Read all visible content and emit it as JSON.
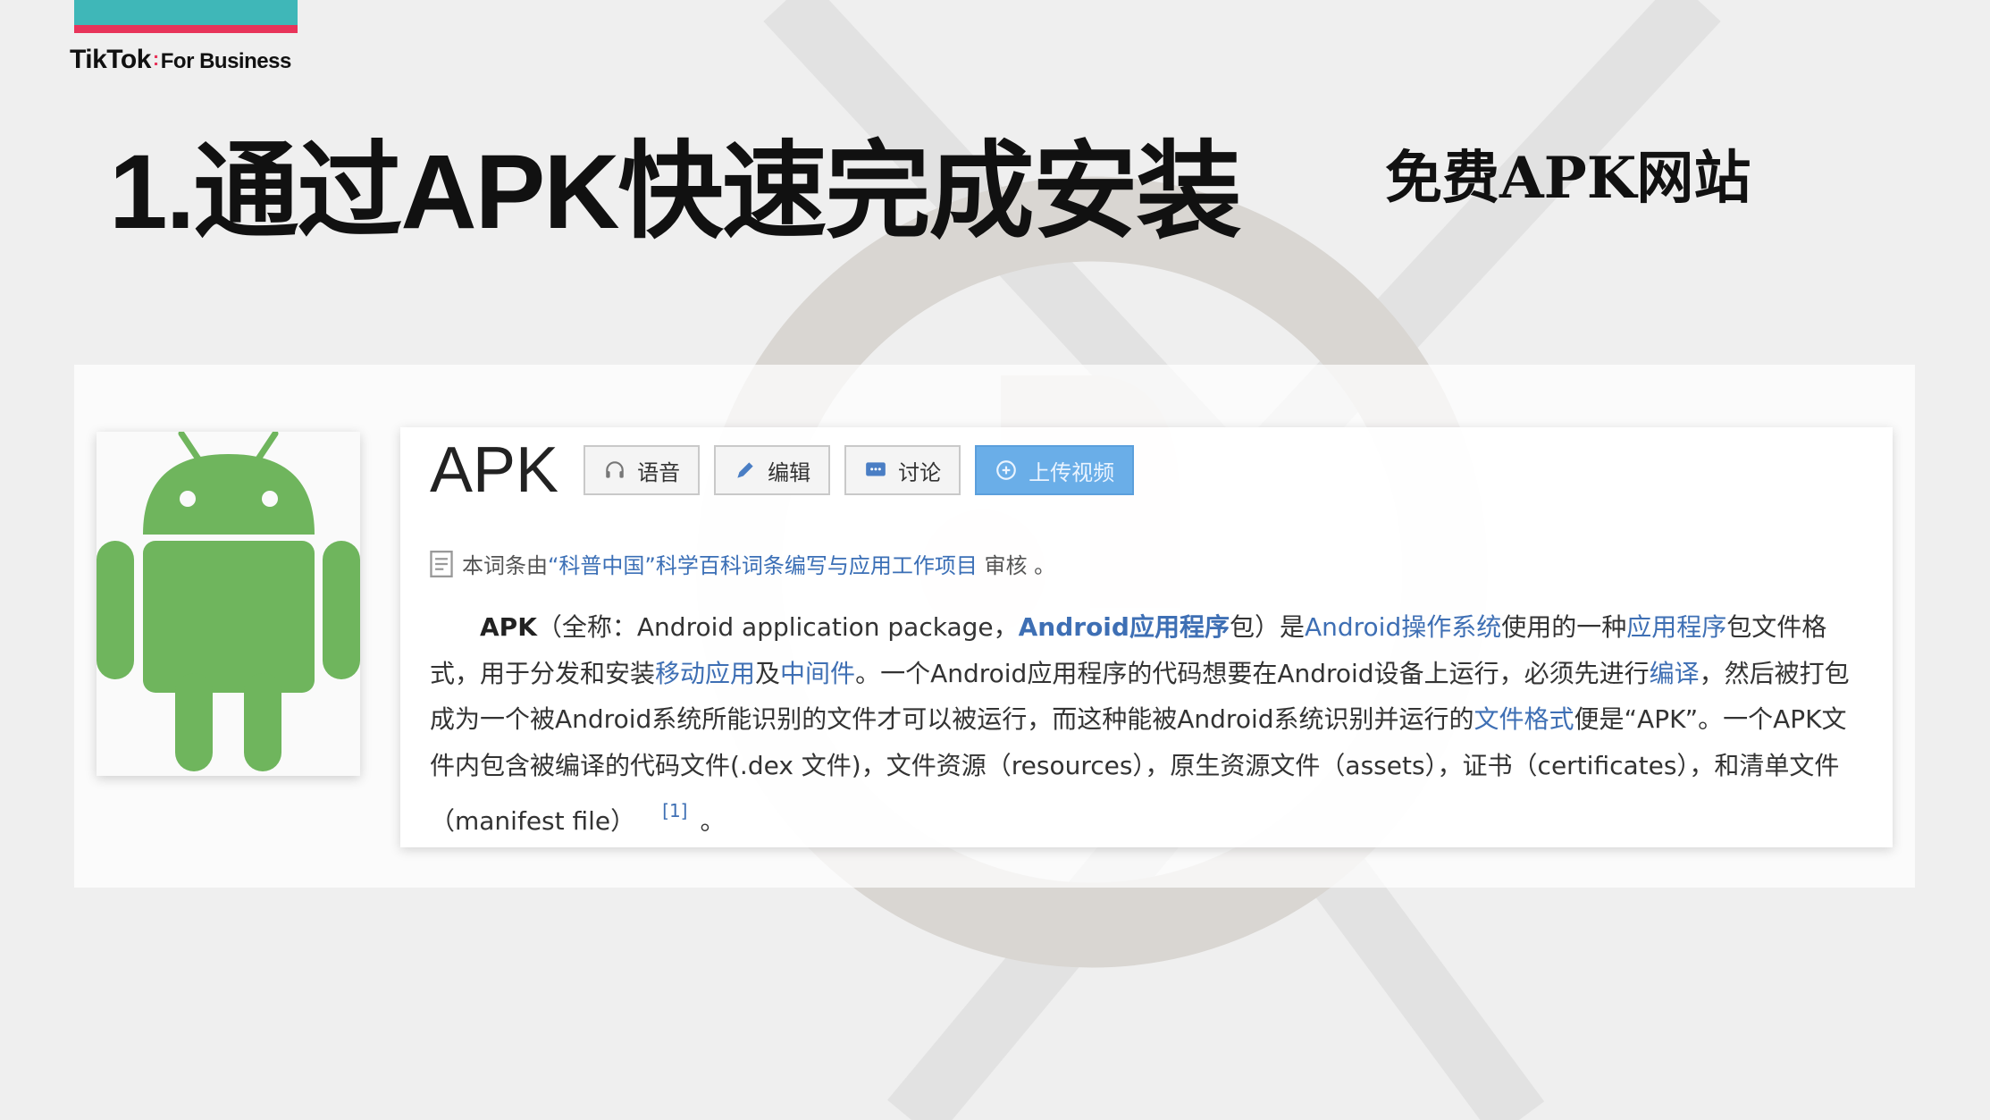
{
  "brand": {
    "logo_text": "TikTok",
    "logo_separator": ":",
    "logo_suffix": "For Business",
    "colors": {
      "teal": "#3fb7b8",
      "pink": "#e8345a"
    }
  },
  "slide": {
    "title": "1.通过APK快速完成安装",
    "side_note": "免费APK网站"
  },
  "entry": {
    "title": "APK",
    "buttons": [
      {
        "label": "语音",
        "icon": "headphones-icon"
      },
      {
        "label": "编辑",
        "icon": "pencil-icon"
      },
      {
        "label": "讨论",
        "icon": "chat-icon"
      },
      {
        "label": "上传视频",
        "icon": "plus-circle-icon"
      }
    ],
    "review": {
      "prefix": "本词条由",
      "link": "“科普中国”科学百科词条编写与应用工作项目",
      "suffix": " 审核 。"
    },
    "body": {
      "s01": "APK",
      "s02": "（全称：Android application package，",
      "s03": "Android应用程序",
      "s04": "包）是",
      "s05": "Android操作系统",
      "s06": "使用的一种",
      "s07": "应用程序",
      "s08": "包文件格式，用于分发和安装",
      "s09": "移动应用",
      "s10": "及",
      "s11": "中间件",
      "s12": "。一个Android应用程序的代码想要在Android设备上运行，必须先进行",
      "s13": "编译",
      "s14": "，然后被打包成为一个被Android系统所能识别的文件才可以被运行，而这种能被Android系统识别并运行的",
      "s15": "文件格式",
      "s16": "便是“APK”。一个APK文件内包含被编译的代码文件(.dex 文件)，文件资源（resources），原生资源文件（assets），证书（certificates），和清单文件（manifest file）",
      "s17": "[1]",
      "s18": "。"
    },
    "android_color": "#6fb55d"
  }
}
